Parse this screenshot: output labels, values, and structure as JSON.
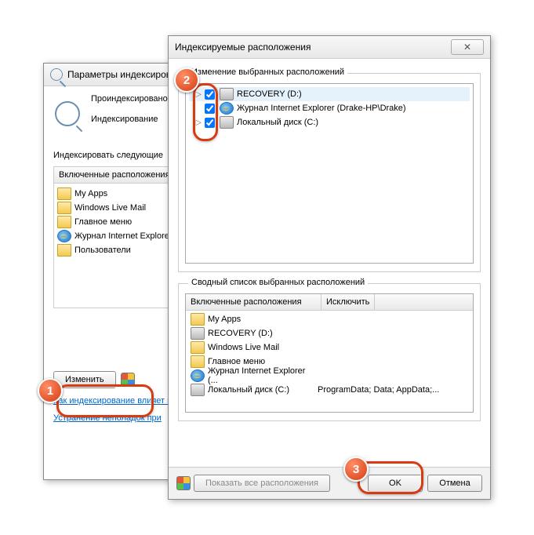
{
  "back": {
    "title": "Параметры индексирования",
    "status1": "Проиндексировано",
    "status2": "Индексирование",
    "section_label": "Индексировать следующие",
    "incl_header": "Включенные расположения",
    "items": [
      {
        "icon": "folder",
        "label": "My Apps"
      },
      {
        "icon": "folder",
        "label": "Windows Live Mail"
      },
      {
        "icon": "folder",
        "label": "Главное меню"
      },
      {
        "icon": "ie",
        "label": "Журнал Internet Explorer"
      },
      {
        "icon": "folder",
        "label": "Пользователи"
      }
    ],
    "modify_btn": "Изменить",
    "link1": "Как индексирование влияет на",
    "link2": "Устранение неполадок при"
  },
  "front": {
    "title": "Индексируемые расположения",
    "tree_label": "Изменение выбранных расположений",
    "tree": [
      {
        "icon": "drive",
        "label": "RECOVERY (D:)",
        "checked": true,
        "selected": true
      },
      {
        "icon": "ie",
        "label": "Журнал Internet Explorer (Drake-HP\\Drake)",
        "checked": true,
        "selected": false
      },
      {
        "icon": "drive",
        "label": "Локальный диск (C:)",
        "checked": true,
        "selected": false
      }
    ],
    "summary_label": "Сводный список выбранных расположений",
    "sum_col1": "Включенные расположения",
    "sum_col2": "Исключить",
    "summary": [
      {
        "icon": "folder",
        "label": "My Apps",
        "ex": ""
      },
      {
        "icon": "drive",
        "label": "RECOVERY (D:)",
        "ex": ""
      },
      {
        "icon": "folder",
        "label": "Windows Live Mail",
        "ex": ""
      },
      {
        "icon": "folder",
        "label": "Главное меню",
        "ex": ""
      },
      {
        "icon": "ie",
        "label": "Журнал Internet Explorer (...",
        "ex": ""
      },
      {
        "icon": "drive",
        "label": "Локальный диск (C:)",
        "ex": "ProgramData; Data; AppData;..."
      }
    ],
    "show_all": "Показать все расположения",
    "ok": "OK",
    "cancel": "Отмена"
  },
  "callouts": {
    "c1": "1",
    "c2": "2",
    "c3": "3"
  }
}
